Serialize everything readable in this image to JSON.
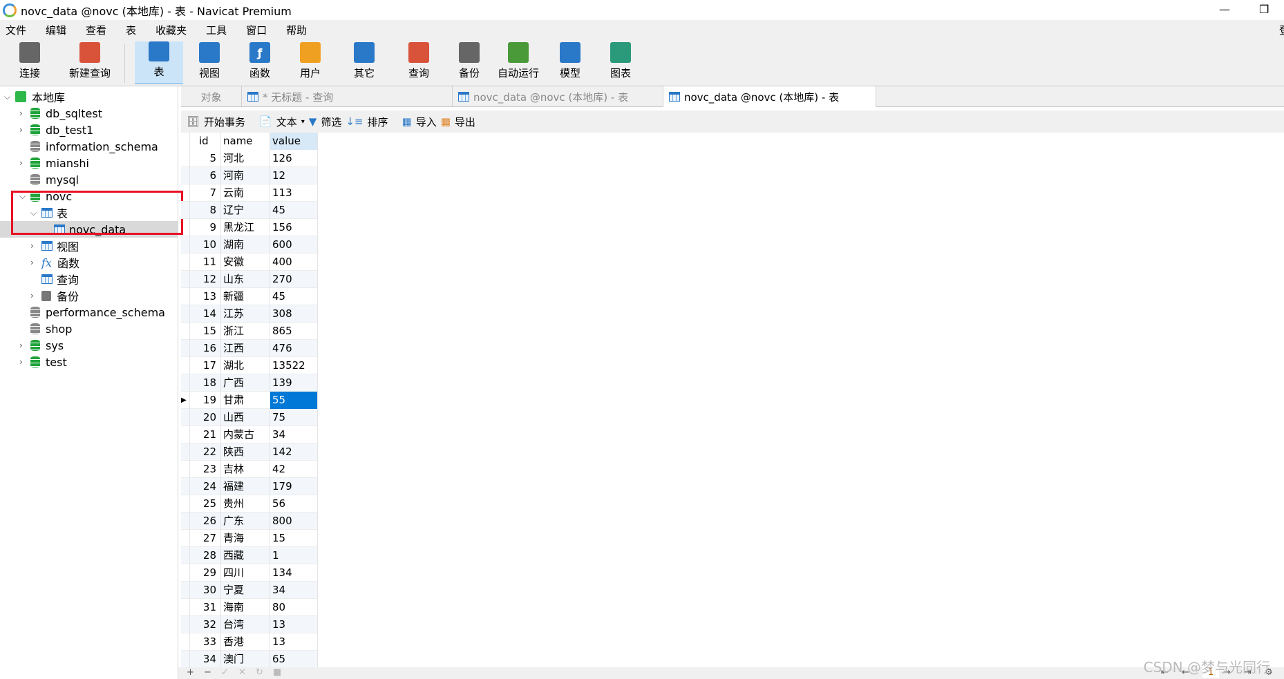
{
  "window": {
    "title": "novc_data @novc (本地库) - 表 - Navicat Premium",
    "minimize": "—",
    "restore": "❐"
  },
  "menu": [
    "文件",
    "编辑",
    "查看",
    "表",
    "收藏夹",
    "工具",
    "窗口",
    "帮助"
  ],
  "menu_right": "登",
  "toolbar": [
    {
      "label": "连接",
      "icon": "plug-icon",
      "color": "#666"
    },
    {
      "label": "新建查询",
      "icon": "new-query-icon",
      "color": "#d9533b"
    },
    {
      "label": "表",
      "icon": "table-icon",
      "color": "#2a78c8",
      "active": true
    },
    {
      "label": "视图",
      "icon": "view-icon",
      "color": "#2a78c8"
    },
    {
      "label": "函数",
      "icon": "function-icon",
      "color": "#2a78c8"
    },
    {
      "label": "用户",
      "icon": "user-icon",
      "color": "#f0a020"
    },
    {
      "label": "其它",
      "icon": "tools-icon",
      "color": "#2a78c8"
    },
    {
      "label": "查询",
      "icon": "query-icon",
      "color": "#d9533b"
    },
    {
      "label": "备份",
      "icon": "backup-icon",
      "color": "#666"
    },
    {
      "label": "自动运行",
      "icon": "schedule-icon",
      "color": "#4a9a3a"
    },
    {
      "label": "模型",
      "icon": "model-icon",
      "color": "#2a78c8"
    },
    {
      "label": "图表",
      "icon": "chart-icon",
      "color": "#2a9a7a"
    }
  ],
  "tree": [
    {
      "label": "本地库",
      "level": 0,
      "arrow": "⌄",
      "icon": "connection"
    },
    {
      "label": "db_sqltest",
      "level": 1,
      "arrow": "›",
      "icon": "db"
    },
    {
      "label": "db_test1",
      "level": 1,
      "arrow": "›",
      "icon": "db"
    },
    {
      "label": "information_schema",
      "level": 1,
      "arrow": "",
      "icon": "dbgray"
    },
    {
      "label": "mianshi",
      "level": 1,
      "arrow": "›",
      "icon": "db"
    },
    {
      "label": "mysql",
      "level": 1,
      "arrow": "",
      "icon": "dbgray"
    },
    {
      "label": "novc",
      "level": 1,
      "arrow": "⌄",
      "icon": "db"
    },
    {
      "label": "表",
      "level": 2,
      "arrow": "⌄",
      "icon": "table"
    },
    {
      "label": "novc_data",
      "level": 3,
      "arrow": "",
      "icon": "table",
      "selected": true
    },
    {
      "label": "视图",
      "level": 2,
      "arrow": "›",
      "icon": "view"
    },
    {
      "label": "函数",
      "level": 2,
      "arrow": "›",
      "icon": "fx"
    },
    {
      "label": "查询",
      "level": 2,
      "arrow": "",
      "icon": "query"
    },
    {
      "label": "备份",
      "level": 2,
      "arrow": "›",
      "icon": "backup"
    },
    {
      "label": "performance_schema",
      "level": 1,
      "arrow": "",
      "icon": "dbgray"
    },
    {
      "label": "shop",
      "level": 1,
      "arrow": "",
      "icon": "dbgray"
    },
    {
      "label": "sys",
      "level": 1,
      "arrow": "›",
      "icon": "db"
    },
    {
      "label": "test",
      "level": 1,
      "arrow": "›",
      "icon": "db"
    }
  ],
  "tabs": {
    "objects": "对象",
    "items": [
      "* 无标题 - 查询",
      "novc_data @novc (本地库) - 表",
      "novc_data @novc (本地库) - 表"
    ]
  },
  "subtoolbar": {
    "begin": "开始事务",
    "text": "文本",
    "filter": "筛选",
    "sort": "排序",
    "import": "导入",
    "export": "导出"
  },
  "grid": {
    "columns": [
      "id",
      "name",
      "value"
    ],
    "selected_id": 19,
    "rows": [
      [
        5,
        "河北",
        "126"
      ],
      [
        6,
        "河南",
        "12"
      ],
      [
        7,
        "云南",
        "113"
      ],
      [
        8,
        "辽宁",
        "45"
      ],
      [
        9,
        "黑龙江",
        "156"
      ],
      [
        10,
        "湖南",
        "600"
      ],
      [
        11,
        "安徽",
        "400"
      ],
      [
        12,
        "山东",
        "270"
      ],
      [
        13,
        "新疆",
        "45"
      ],
      [
        14,
        "江苏",
        "308"
      ],
      [
        15,
        "浙江",
        "865"
      ],
      [
        16,
        "江西",
        "476"
      ],
      [
        17,
        "湖北",
        "13522"
      ],
      [
        18,
        "广西",
        "139"
      ],
      [
        19,
        "甘肃",
        "55"
      ],
      [
        20,
        "山西",
        "75"
      ],
      [
        21,
        "内蒙古",
        "34"
      ],
      [
        22,
        "陕西",
        "142"
      ],
      [
        23,
        "吉林",
        "42"
      ],
      [
        24,
        "福建",
        "179"
      ],
      [
        25,
        "贵州",
        "56"
      ],
      [
        26,
        "广东",
        "800"
      ],
      [
        27,
        "青海",
        "15"
      ],
      [
        28,
        "西藏",
        "1"
      ],
      [
        29,
        "四川",
        "134"
      ],
      [
        30,
        "宁夏",
        "34"
      ],
      [
        31,
        "海南",
        "80"
      ],
      [
        32,
        "台湾",
        "13"
      ],
      [
        33,
        "香港",
        "13"
      ],
      [
        34,
        "澳门",
        "65"
      ]
    ]
  },
  "bottom": {
    "buttons": [
      "+",
      "−",
      "✓",
      "✕",
      "↻",
      "■"
    ],
    "pager": [
      "⇤",
      "←",
      "1",
      "→",
      "⇥",
      "⚙"
    ]
  },
  "watermark": "CSDN @梦与光同行"
}
